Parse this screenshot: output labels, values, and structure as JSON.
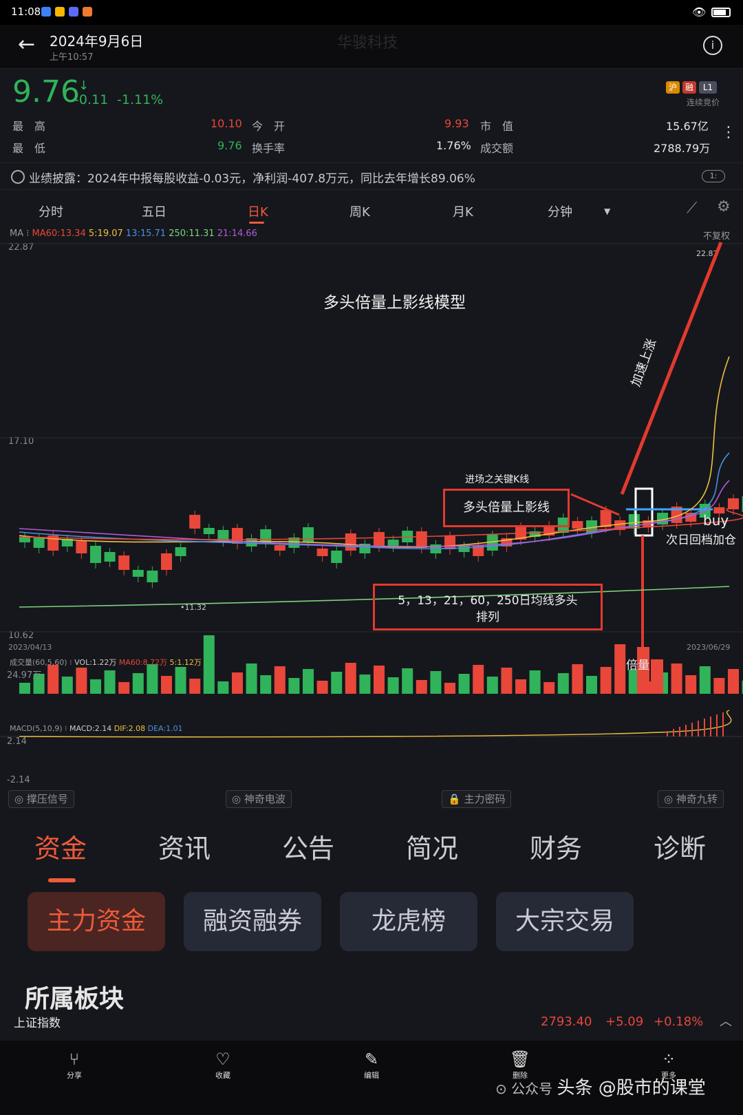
{
  "status": {
    "time": "11:08"
  },
  "header": {
    "date": "2024年9月6日",
    "subtime": "上午10:57",
    "blurred_title": "华骏科技"
  },
  "quote": {
    "price": "9.76",
    "change": "-0.11",
    "change_pct": "-1.11%",
    "stats": [
      {
        "label": "最　高",
        "value": "10.10",
        "color": "red"
      },
      {
        "label": "今　开",
        "value": "9.93",
        "color": "red"
      },
      {
        "label": "市　值",
        "value": "15.67亿",
        "color": "white"
      },
      {
        "label": "最　低",
        "value": "9.76",
        "color": "green"
      },
      {
        "label": "换手率",
        "value": "1.76%",
        "color": "white"
      },
      {
        "label": "成交额",
        "value": "2788.79万",
        "color": "white"
      }
    ],
    "badges": [
      "沪",
      "融",
      "L1"
    ],
    "auction": "连续竞价"
  },
  "notice": {
    "text": "业绩披露：2024年中报每股收益-0.03元，净利润-407.8万元，同比去年增长89.06%",
    "page": "1:"
  },
  "ktabs": [
    "分时",
    "五日",
    "日K",
    "周K",
    "月K",
    "分钟"
  ],
  "ma": {
    "prefix": "MA",
    "items": [
      {
        "text": "MA60:13.34",
        "color": "#e8473a"
      },
      {
        "text": "5:19.07",
        "color": "#f0c040"
      },
      {
        "text": "13:15.71",
        "color": "#4a90e2"
      },
      {
        "text": "250:11.31",
        "color": "#7ed37e"
      },
      {
        "text": "21:14.66",
        "color": "#b05ad8"
      }
    ],
    "fq": "不复权"
  },
  "chart_axis": {
    "y_top": "22.87",
    "y_mid": "17.10",
    "y_bot": "10.62",
    "date_left": "2023/04/13",
    "date_right": "2023/06/29",
    "min_mark": "11.32",
    "max_mark": "22.87"
  },
  "volume": {
    "header": "成交量(60,5,60)",
    "vol": "VOL:1.22万",
    "ma60": "MA60:8.72万",
    "ma5": "5:1.12万",
    "max": "24.97万"
  },
  "macd": {
    "header": "MACD(5,10,9)",
    "macd": "MACD:2.14",
    "dif": "DIF:2.08",
    "dea": "DEA:1.01",
    "top": "2.14",
    "bottom": "-2.14"
  },
  "annotations": {
    "title": "多头倍量上影线模型",
    "key_k_label": "进场之关键K线",
    "box1": "多头倍量上影线",
    "box2_line1": "5，13，21，60，250日均线多头",
    "box2_line2": "排列",
    "accel": "加速上涨",
    "buy": "buy",
    "next_day": "次日回档加仓",
    "double_vol": "倍量"
  },
  "signals": [
    "撑压信号",
    "神奇电波",
    "主力密码",
    "神奇九转"
  ],
  "bottom_tabs": [
    "资金",
    "资讯",
    "公告",
    "简况",
    "财务",
    "诊断"
  ],
  "sub_buttons": [
    "主力资金",
    "融资融券",
    "龙虎榜",
    "大宗交易"
  ],
  "section_title": "所属板块",
  "index_bar": {
    "name": "上证指数",
    "value": "2793.40",
    "change": "+5.09",
    "pct": "+0.18%"
  },
  "nav": [
    {
      "label": "分享",
      "icon": "share-icon"
    },
    {
      "label": "收藏",
      "icon": "heart-icon"
    },
    {
      "label": "编辑",
      "icon": "edit-icon"
    },
    {
      "label": "删除",
      "icon": "trash-icon"
    },
    {
      "label": "更多",
      "icon": "more-icon"
    }
  ],
  "watermark": "头条 @股市的课堂"
}
